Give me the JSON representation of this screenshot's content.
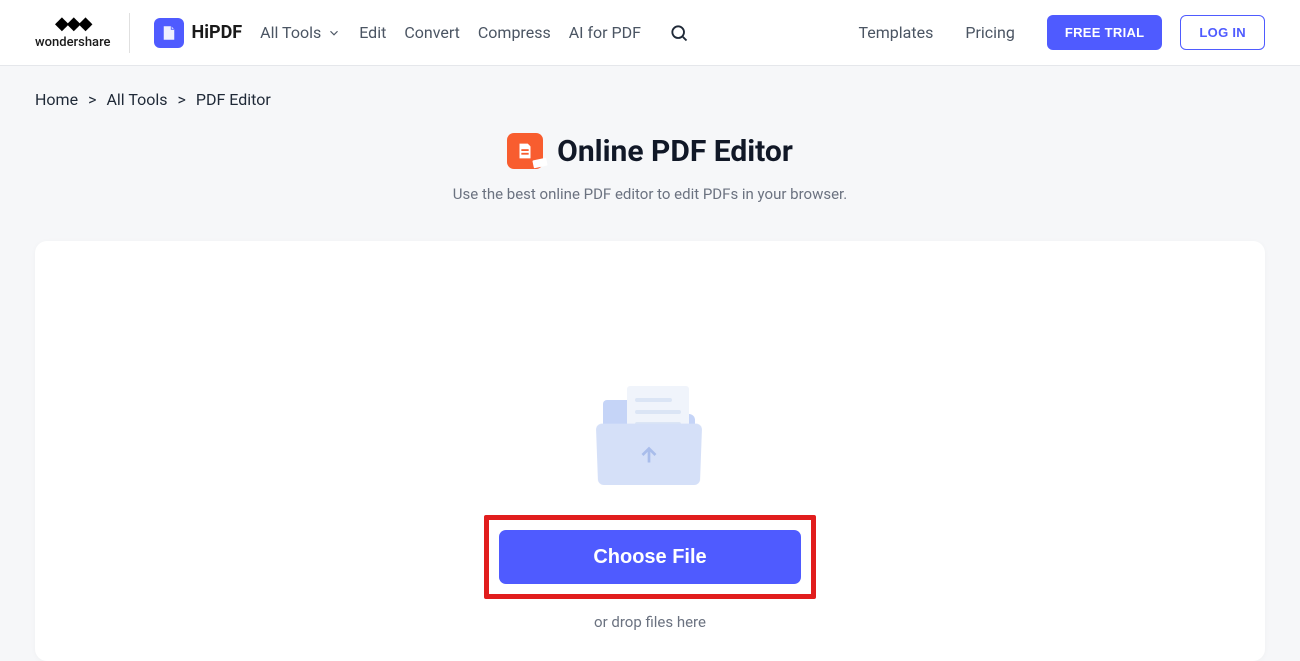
{
  "header": {
    "parent_brand": "wondershare",
    "brand": "HiPDF",
    "nav": {
      "all_tools": "All Tools",
      "edit": "Edit",
      "convert": "Convert",
      "compress": "Compress",
      "ai_for_pdf": "AI for PDF"
    },
    "right_nav": {
      "templates": "Templates",
      "pricing": "Pricing",
      "free_trial": "FREE TRIAL",
      "login": "LOG IN"
    }
  },
  "breadcrumb": {
    "items": [
      "Home",
      "All Tools",
      "PDF Editor"
    ],
    "separator": ">"
  },
  "page": {
    "title": "Online PDF Editor",
    "subtitle": "Use the best online PDF editor to edit PDFs in your browser."
  },
  "upload": {
    "choose_file": "Choose File",
    "drop_hint": "or drop files here"
  }
}
